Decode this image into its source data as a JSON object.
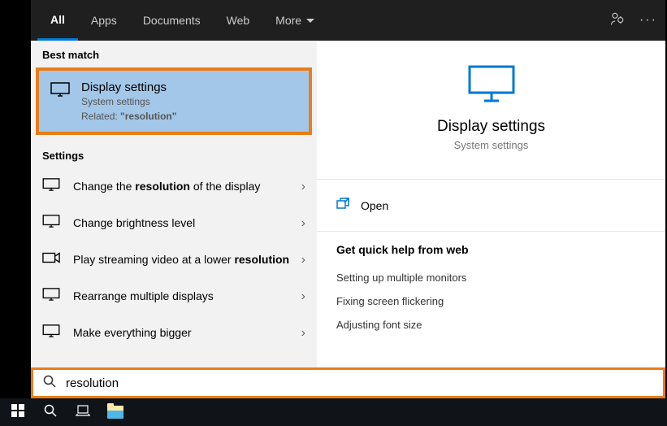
{
  "tabs": {
    "all": "All",
    "apps": "Apps",
    "documents": "Documents",
    "web": "Web",
    "more": "More"
  },
  "sections": {
    "best_match": "Best match",
    "settings": "Settings"
  },
  "best_match": {
    "title": "Display settings",
    "subtitle": "System settings",
    "related_prefix": "Related: ",
    "related_term": "\"resolution\""
  },
  "settings_items": [
    {
      "text_before": "Change the ",
      "bold": "resolution",
      "text_after": " of the display"
    },
    {
      "text_before": "Change brightness level",
      "bold": "",
      "text_after": ""
    },
    {
      "text_before": "Play streaming video at a lower ",
      "bold": "resolution",
      "text_after": ""
    },
    {
      "text_before": "Rearrange multiple displays",
      "bold": "",
      "text_after": ""
    },
    {
      "text_before": "Make everything bigger",
      "bold": "",
      "text_after": ""
    }
  ],
  "detail": {
    "title": "Display settings",
    "subtitle": "System settings",
    "open": "Open",
    "help_header": "Get quick help from web",
    "help_links": [
      "Setting up multiple monitors",
      "Fixing screen flickering",
      "Adjusting font size"
    ]
  },
  "search": {
    "value": "resolution"
  },
  "colors": {
    "accent": "#0078d4",
    "highlight_border": "#e87d1a"
  }
}
